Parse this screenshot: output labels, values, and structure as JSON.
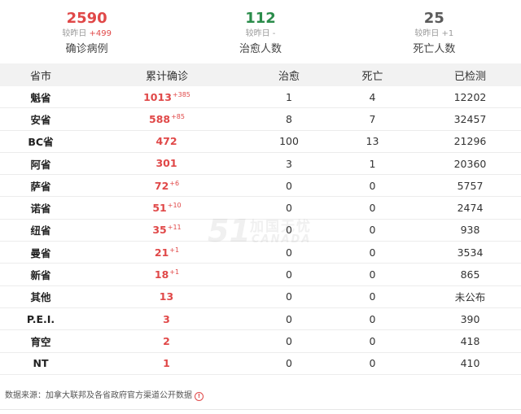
{
  "summary": {
    "confirmed": {
      "value": "2590",
      "delta_prefix": "较昨日",
      "delta": "+499",
      "label": "确诊病例",
      "color": "#e04848"
    },
    "recovered": {
      "value": "112",
      "delta_prefix": "较昨日",
      "delta": "-",
      "label": "治愈人数",
      "color": "#2a8c4a"
    },
    "deaths": {
      "value": "25",
      "delta_prefix": "较昨日",
      "delta": "+1",
      "label": "死亡人数",
      "color": "#5b5b5b"
    }
  },
  "table": {
    "headers": [
      "省市",
      "累计确诊",
      "治愈",
      "死亡",
      "已检测"
    ],
    "rows": [
      {
        "province": "魁省",
        "confirmed": "1013",
        "increase": "+385",
        "recovered": "1",
        "deaths": "4",
        "tested": "12202"
      },
      {
        "province": "安省",
        "confirmed": "588",
        "increase": "+85",
        "recovered": "8",
        "deaths": "7",
        "tested": "32457"
      },
      {
        "province": "BC省",
        "confirmed": "472",
        "increase": "",
        "recovered": "100",
        "deaths": "13",
        "tested": "21296"
      },
      {
        "province": "阿省",
        "confirmed": "301",
        "increase": "",
        "recovered": "3",
        "deaths": "1",
        "tested": "20360"
      },
      {
        "province": "萨省",
        "confirmed": "72",
        "increase": "+6",
        "recovered": "0",
        "deaths": "0",
        "tested": "5757"
      },
      {
        "province": "诺省",
        "confirmed": "51",
        "increase": "+10",
        "recovered": "0",
        "deaths": "0",
        "tested": "2474"
      },
      {
        "province": "纽省",
        "confirmed": "35",
        "increase": "+11",
        "recovered": "0",
        "deaths": "0",
        "tested": "938"
      },
      {
        "province": "曼省",
        "confirmed": "21",
        "increase": "+1",
        "recovered": "0",
        "deaths": "0",
        "tested": "3534"
      },
      {
        "province": "新省",
        "confirmed": "18",
        "increase": "+1",
        "recovered": "0",
        "deaths": "0",
        "tested": "865"
      },
      {
        "province": "其他",
        "confirmed": "13",
        "increase": "",
        "recovered": "0",
        "deaths": "0",
        "tested": "未公布"
      },
      {
        "province": "P.E.I.",
        "confirmed": "3",
        "increase": "",
        "recovered": "0",
        "deaths": "0",
        "tested": "390"
      },
      {
        "province": "育空",
        "confirmed": "2",
        "increase": "",
        "recovered": "0",
        "deaths": "0",
        "tested": "418"
      },
      {
        "province": "NT",
        "confirmed": "1",
        "increase": "",
        "recovered": "0",
        "deaths": "0",
        "tested": "410"
      }
    ]
  },
  "watermark": {
    "number": "51",
    "cn": "加国无忧",
    "en": "CANADA"
  },
  "footer": {
    "source": "数据来源：加拿大联邦及各省政府官方渠道公开数据",
    "icon": "info-icon",
    "icon_glyph": "!"
  }
}
